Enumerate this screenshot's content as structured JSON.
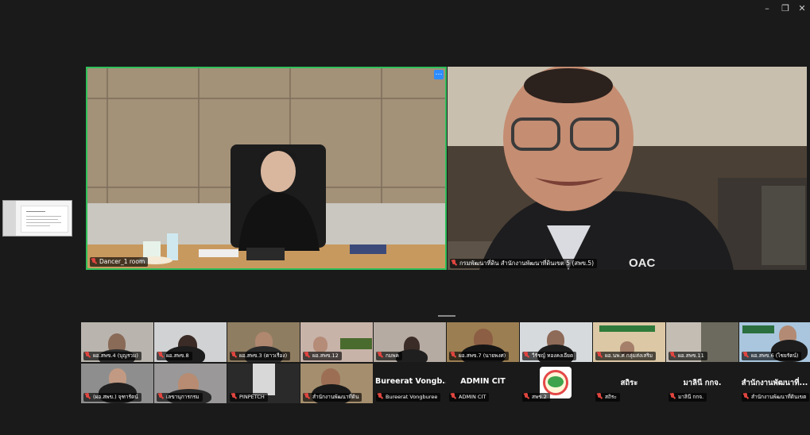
{
  "window": {
    "minimize_icon": "minimize-icon",
    "restore_icon": "restore-icon",
    "close_icon": "close-icon"
  },
  "main_videos": [
    {
      "name": "Dancer_1 room",
      "muted": true,
      "active_speaker": true
    },
    {
      "name": "กรมพัฒนาที่ดิน สำนักงานพัฒนาที่ดินเขต 5 (สพข.5)",
      "muted": true
    }
  ],
  "gallery_rows": [
    [
      {
        "name": "ผอ.สพข.4 (บุญรวม)",
        "video": true
      },
      {
        "name": "ผอ.สพข.8",
        "video": true
      },
      {
        "name": "ผอ.สพข.3 (ดาวเรือง)",
        "video": true
      },
      {
        "name": "ผอ.สพข.12",
        "video": true
      },
      {
        "name": "กมพค",
        "video": true
      },
      {
        "name": "ผอ.สพข.7 (นายพงศ)",
        "video": true
      },
      {
        "name": "วีรัชญ์ ทองคงเอียด",
        "video": true
      },
      {
        "name": "ผอ.นพ.ศ กลุ่มส่งเสริม",
        "video": true
      },
      {
        "name": "ผอ.สพข.11",
        "video": true
      },
      {
        "name": "ผอ.สพข.6 (ไชยรัตน์)",
        "video": true
      }
    ],
    [
      {
        "name": "(ผอ.สพข.) จุฑารัตน์",
        "video": true
      },
      {
        "name": "เลขานุการกรม",
        "video": true
      },
      {
        "name": "PINPETCH",
        "video": true
      },
      {
        "name": "สำนักงานพัฒนาที่ดิน",
        "video": true
      },
      {
        "name": "Bureerat Vongburee",
        "display": "Bureerat Vongb...",
        "video": false
      },
      {
        "name": "ADMIN CIT",
        "display": "ADMIN CIT",
        "video": false
      },
      {
        "name": "สพข.2",
        "video": false,
        "logo": true
      },
      {
        "name": "สถิระ",
        "display": "สถิระ",
        "video": false
      },
      {
        "name": "มาลินี กกจ.",
        "display": "มาลินี กกจ.",
        "video": false
      },
      {
        "name": "สำนักงานพัฒนาที่ดินเขต",
        "display": "สำนักงานพัฒนาที่...",
        "video": false
      }
    ]
  ]
}
